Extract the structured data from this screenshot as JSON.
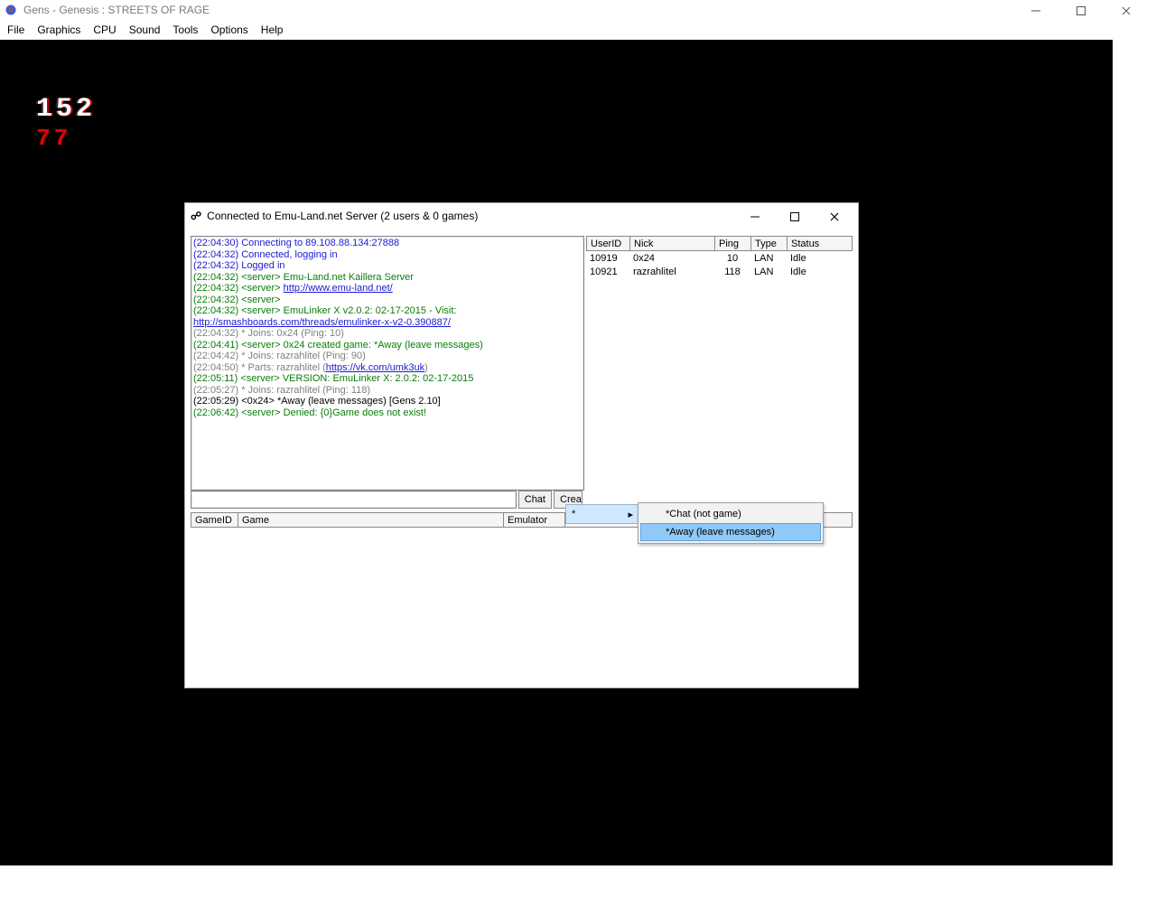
{
  "window": {
    "title": "Gens - Genesis : STREETS OF RAGE"
  },
  "menubar": [
    "File",
    "Graphics",
    "CPU",
    "Sound",
    "Tools",
    "Options",
    "Help"
  ],
  "hud": {
    "top": "152",
    "bottom": "77"
  },
  "dialog": {
    "title": "Connected to Emu-Land.net Server (2 users & 0 games)",
    "chat_button": "Chat",
    "create_button": "Create",
    "chat_input_value": ""
  },
  "log": [
    {
      "cls": "c-blue",
      "t": "(22:04:30) Connecting to 89.108.88.134:27888"
    },
    {
      "cls": "c-blue",
      "t": "(22:04:32) Connected, logging in"
    },
    {
      "cls": "c-blue",
      "t": "(22:04:32) Logged in"
    },
    {
      "cls": "c-green",
      "t": "(22:04:32) <server> Emu-Land.net Kaillera Server"
    },
    {
      "cls": "c-green",
      "t": "(22:04:32) <server> ",
      "link": "http://www.emu-land.net/"
    },
    {
      "cls": "c-green",
      "t": "(22:04:32) <server> "
    },
    {
      "cls": "c-green",
      "t": "(22:04:32) <server> EmuLinker X v2.0.2: 02-17-2015 - Visit:"
    },
    {
      "cls": "c-link",
      "t": "http://smashboards.com/threads/emulinker-x-v2-0.390887/"
    },
    {
      "cls": "c-gray",
      "t": "(22:04:32) * Joins: 0x24 (Ping: 10)"
    },
    {
      "cls": "c-green",
      "t": "(22:04:41) <server> 0x24 created game: *Away (leave messages)"
    },
    {
      "cls": "c-gray",
      "t": "(22:04:42) * Joins: razrahlitel (Ping: 90)"
    },
    {
      "cls": "c-gray",
      "t": "(22:04:50) * Parts: razrahlitel (",
      "link": "https://vk.com/umk3uk",
      "tail": ")"
    },
    {
      "cls": "c-green",
      "t": "(22:05:11) <server> VERSION: EmuLinker X: 2.0.2: 02-17-2015"
    },
    {
      "cls": "c-gray",
      "t": "(22:05:27) * Joins: razrahlitel (Ping: 118)"
    },
    {
      "cls": "c-black",
      "t": "(22:05:29) <0x24> *Away (leave messages) [Gens 2.10]"
    },
    {
      "cls": "c-green",
      "t": "(22:06:42) <server> Denied: {0}Game does not exist!"
    }
  ],
  "user_table": {
    "headers": {
      "userid": "UserID",
      "nick": "Nick",
      "ping": "Ping",
      "type": "Type",
      "status": "Status"
    },
    "rows": [
      {
        "userid": "10919",
        "nick": "0x24",
        "ping": "10",
        "type": "LAN",
        "status": "Idle"
      },
      {
        "userid": "10921",
        "nick": "razrahlitel",
        "ping": "118",
        "type": "LAN",
        "status": "Idle"
      }
    ]
  },
  "game_table": {
    "headers": {
      "gameid": "GameID",
      "game": "Game",
      "emulator": "Emulator"
    }
  },
  "context_menu": {
    "root": "*",
    "items": [
      {
        "label": "*Chat (not game)",
        "selected": false
      },
      {
        "label": "*Away (leave messages)",
        "selected": true
      }
    ]
  }
}
